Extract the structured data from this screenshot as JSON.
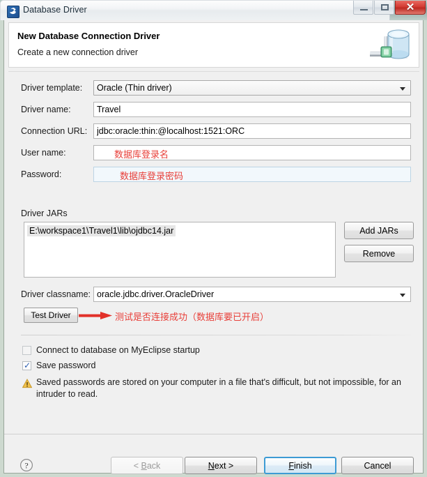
{
  "window": {
    "title": "Database Driver",
    "icon": "myeclipse-logo-icon",
    "minimize_label": "",
    "maximize_label": "",
    "close_label": "✕"
  },
  "banner": {
    "title": "New Database Connection Driver",
    "subtitle": "Create a new connection driver",
    "icon": "database-cylinder-icon"
  },
  "form": {
    "driver_template": {
      "label": "Driver template:",
      "value": "Oracle (Thin driver)",
      "control": "dropdown"
    },
    "driver_name": {
      "label": "Driver name:",
      "value": "Travel",
      "placeholder": ""
    },
    "connection_url": {
      "label": "Connection URL:",
      "value": "jdbc:oracle:thin:@localhost:1521:ORC",
      "placeholder": ""
    },
    "user_name": {
      "label": "User name:",
      "value": "",
      "placeholder": "",
      "annotation": "数据库登录名"
    },
    "password": {
      "label": "Password:",
      "value": "",
      "placeholder": "",
      "annotation": "数据库登录密码",
      "focused": true
    },
    "driver_classname": {
      "label": "Driver classname:",
      "value": "oracle.jdbc.driver.OracleDriver",
      "control": "dropdown"
    }
  },
  "driver_jars": {
    "label": "Driver JARs",
    "items": [
      "E:\\workspace1\\Travel1\\lib\\ojdbc14.jar"
    ],
    "add_label": "Add JARs",
    "remove_label": "Remove"
  },
  "test_driver": {
    "button_label": "Test Driver",
    "annotation": "测试是否连接成功（数据库要已开启）",
    "arrow_icon": "red-arrow-right-icon"
  },
  "options": {
    "connect_on_startup": {
      "label": "Connect to database on MyEclipse startup",
      "checked": false
    },
    "save_password": {
      "label": "Save password",
      "checked": true,
      "check_glyph": "✓"
    }
  },
  "warning": {
    "icon": "warning-triangle-icon",
    "text": "Saved passwords are stored on your computer in a file that's difficult, but not impossible, for an intruder to read."
  },
  "footer": {
    "help_icon": "help-question-icon",
    "back": {
      "label": "< Back",
      "mnemonic": "B",
      "disabled": true
    },
    "next": {
      "label": "Next >",
      "mnemonic": "N",
      "disabled": false
    },
    "finish": {
      "label": "Finish",
      "mnemonic": "F",
      "default": true
    },
    "cancel": {
      "label": "Cancel",
      "mnemonic": "",
      "disabled": false
    }
  },
  "colors": {
    "accent_blue": "#3d9bd4",
    "annotation_red": "#e8403a",
    "close_red": "#d33c34",
    "frame_green": "#cdd9cf",
    "warning_amber": "#e8a317"
  }
}
